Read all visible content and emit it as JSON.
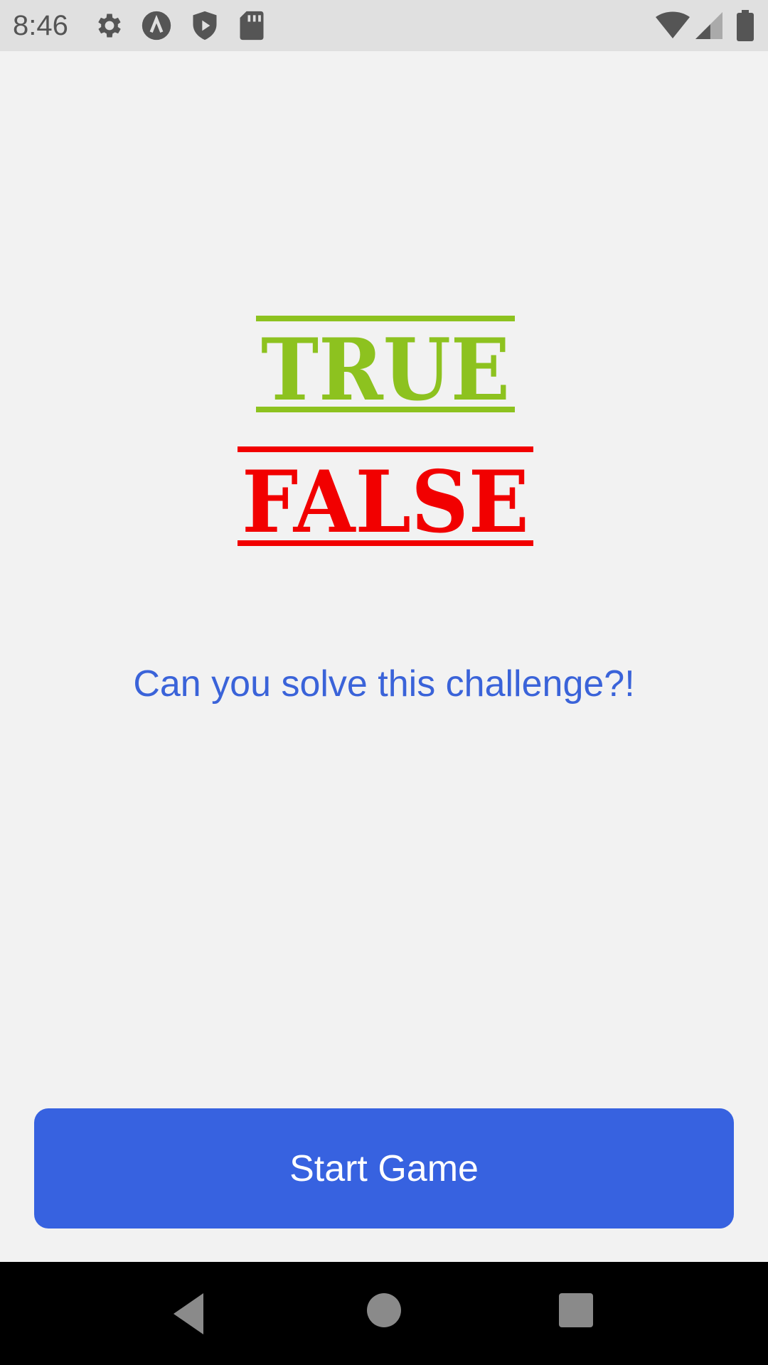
{
  "status_bar": {
    "time": "8:46",
    "left_icons": [
      "gear-icon",
      "app-lambda-icon",
      "shield-play-icon",
      "sd-card-icon"
    ],
    "right_icons": [
      "wifi-icon",
      "cell-signal-icon",
      "battery-icon"
    ]
  },
  "logo": {
    "word_true": "TRUE",
    "word_false": "FALSE",
    "true_color": "#8dc21f",
    "false_color": "#f20000"
  },
  "tagline": "Can you solve this challenge?!",
  "start_button": {
    "label": "Start Game",
    "color": "#3762e0"
  },
  "nav_bar": {
    "buttons": [
      "back-icon",
      "home-icon",
      "recents-icon"
    ]
  }
}
